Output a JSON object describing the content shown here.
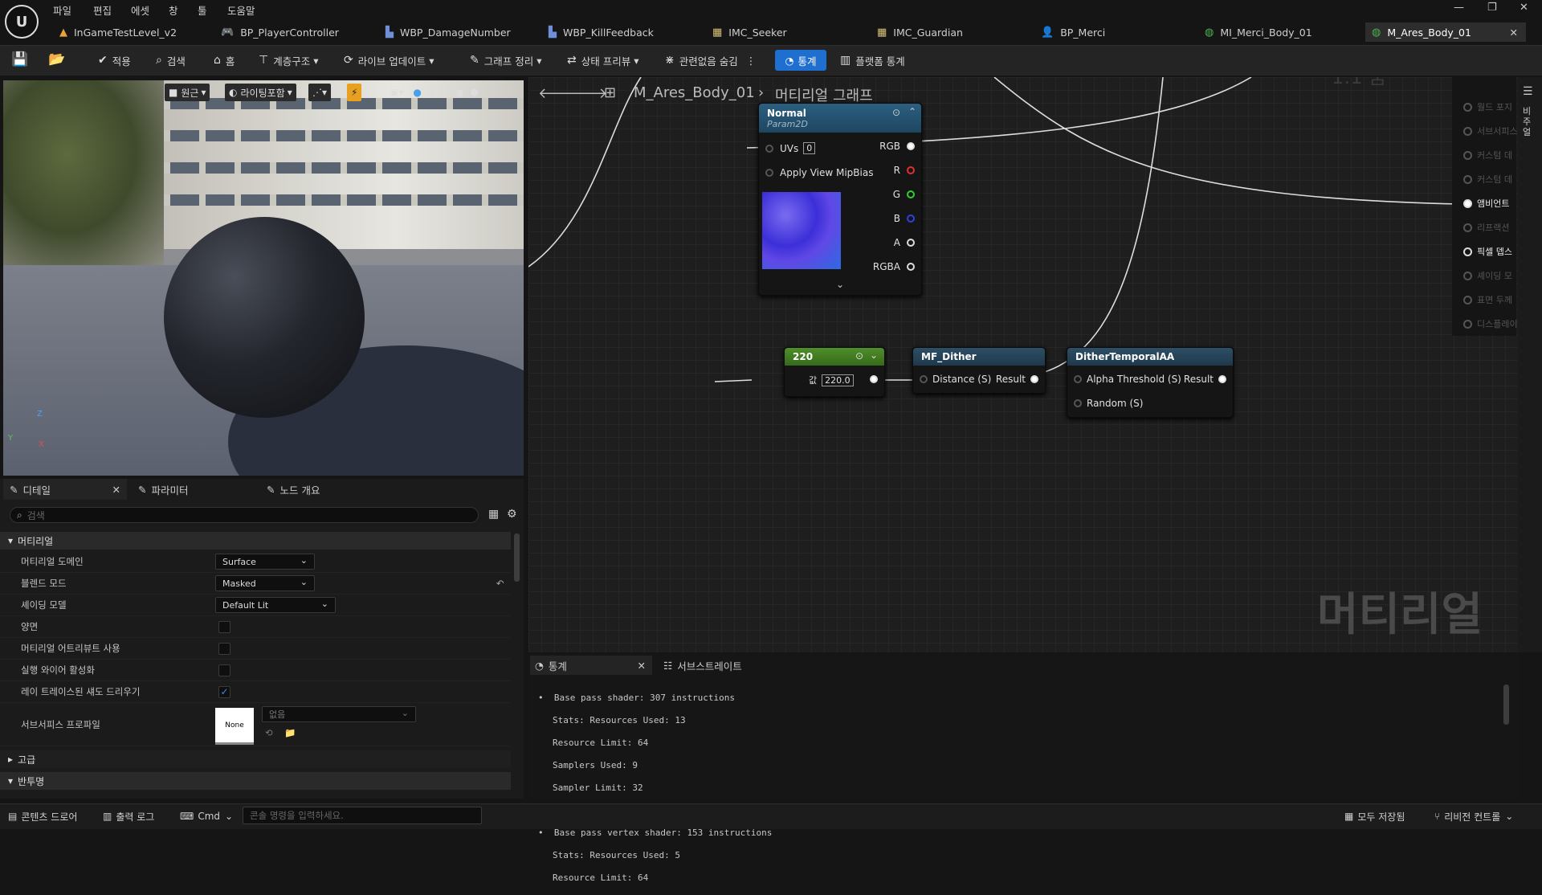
{
  "menu": [
    "파일",
    "편집",
    "에셋",
    "창",
    "툴",
    "도움말"
  ],
  "tabs": [
    {
      "label": "InGameTestLevel_v2",
      "icon": "level-icon"
    },
    {
      "label": "BP_PlayerController",
      "icon": "controller-icon"
    },
    {
      "label": "WBP_DamageNumber",
      "icon": "widget-icon"
    },
    {
      "label": "WBP_KillFeedback",
      "icon": "widget-icon"
    },
    {
      "label": "IMC_Seeker",
      "icon": "input-icon"
    },
    {
      "label": "IMC_Guardian",
      "icon": "input-icon"
    },
    {
      "label": "BP_Merci",
      "icon": "character-icon"
    },
    {
      "label": "MI_Merci_Body_01",
      "icon": "material-instance-icon"
    },
    {
      "label": "M_Ares_Body_01",
      "icon": "material-icon"
    }
  ],
  "toolbar": {
    "apply": "적용",
    "search": "검색",
    "home": "홈",
    "hierarchy": "계층구조",
    "live_update": "라이브 업데이트",
    "graph_cleanup": "그래프 정리",
    "state_preview": "상태 프리뷰",
    "hide_unrelated": "관련없음 숨김",
    "stats": "통계",
    "platform_stats": "플랫폼 통계"
  },
  "viewport": {
    "perspective": "원근",
    "lighting": "라이팅포함",
    "axis_z": "Z",
    "axis_y": "Y",
    "axis_x": "X"
  },
  "details": {
    "tabs": [
      "디테일",
      "파라미터",
      "노드 개요"
    ],
    "search_placeholder": "검색",
    "section_material": "머티리얼",
    "props": [
      {
        "label": "머티리얼 도메인",
        "value": "Surface"
      },
      {
        "label": "블렌드 모드",
        "value": "Masked"
      },
      {
        "label": "셰이딩 모델",
        "value": "Default Lit"
      },
      {
        "label": "양면"
      },
      {
        "label": "머티리얼 어트리뷰트 사용"
      },
      {
        "label": "실행 와이어 활성화"
      },
      {
        "label": "레이 트레이스된 섀도 드리우기"
      },
      {
        "label": "서브서피스 프로파일",
        "value": "없음",
        "thumb": "None"
      }
    ],
    "checks": [
      false,
      false,
      false,
      true
    ],
    "section_advanced": "고급",
    "section_translucency": "반투명"
  },
  "graph": {
    "breadcrumb_asset": "M_Ares_Body_01",
    "breadcrumb_graph": "머티리얼 그래프",
    "watermark": "머티리얼",
    "zoom": "1:1 줌",
    "node_tex": {
      "title": "Normal",
      "subtitle": "Param2D",
      "uvs_label": "UVs",
      "uvs_value": "0",
      "mip_label": "Apply View MipBias",
      "out": [
        "RGB",
        "R",
        "G",
        "B",
        "A",
        "RGBA"
      ]
    },
    "node_const": {
      "title": "220",
      "value_label": "값",
      "value": "220.0"
    },
    "node_dither": {
      "title": "MF_Dither",
      "in": "Distance (S)",
      "out": "Result"
    },
    "node_taa": {
      "title": "DitherTemporalAA",
      "in1": "Alpha Threshold (S)",
      "in2": "Random (S)",
      "out": "Result"
    },
    "result_pins": [
      "월드 포지",
      "서브서피스",
      "커스텀 데",
      "커스텀 데",
      "앰비언트 ",
      "리프랙션 ",
      "픽셀 뎁스",
      "셰이딩 모",
      "표면 두께",
      "디스플레이"
    ],
    "side_strip": "비주얼"
  },
  "stats_panel": {
    "tabs": [
      "통계",
      "서브스트레이트"
    ],
    "lines": [
      "Base pass shader: 307 instructions",
      "Stats: Resources Used: 13",
      "Resource Limit: 64",
      "Samplers Used: 9",
      "Sampler Limit: 32",
      "",
      "Base pass vertex shader: 153 instructions",
      "Stats: Resources Used: 5",
      "Resource Limit: 64"
    ]
  },
  "bottom": {
    "content_drawer": "콘텐츠 드로어",
    "output_log": "출력 로그",
    "cmd": "Cmd",
    "cmd_placeholder": "콘솔 명령을 입력하세요.",
    "save_all": "모두 저장됨",
    "revision": "리비전 컨트롤"
  }
}
